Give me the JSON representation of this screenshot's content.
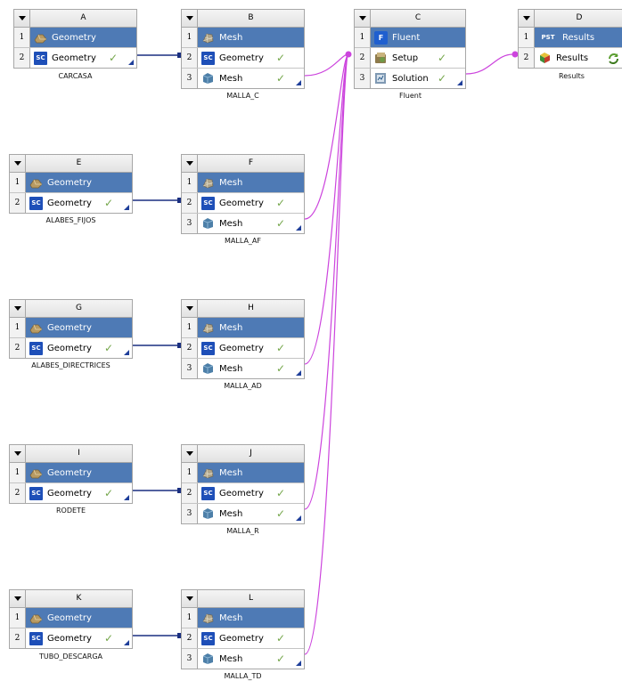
{
  "systems": {
    "A": {
      "letter": "A",
      "name": "CARCASA",
      "rows": [
        {
          "num": "1",
          "label": "Geometry"
        },
        {
          "num": "2",
          "label": "Geometry"
        }
      ]
    },
    "B": {
      "letter": "B",
      "name": "MALLA_C",
      "rows": [
        {
          "num": "1",
          "label": "Mesh"
        },
        {
          "num": "2",
          "label": "Geometry"
        },
        {
          "num": "3",
          "label": "Mesh"
        }
      ]
    },
    "C": {
      "letter": "C",
      "name": "Fluent",
      "rows": [
        {
          "num": "1",
          "label": "Fluent"
        },
        {
          "num": "2",
          "label": "Setup"
        },
        {
          "num": "3",
          "label": "Solution"
        }
      ]
    },
    "D": {
      "letter": "D",
      "name": "Results",
      "rows": [
        {
          "num": "1",
          "label": "Results"
        },
        {
          "num": "2",
          "label": "Results"
        }
      ]
    },
    "E": {
      "letter": "E",
      "name": "ALABES_FIJOS",
      "rows": [
        {
          "num": "1",
          "label": "Geometry"
        },
        {
          "num": "2",
          "label": "Geometry"
        }
      ]
    },
    "F": {
      "letter": "F",
      "name": "MALLA_AF",
      "rows": [
        {
          "num": "1",
          "label": "Mesh"
        },
        {
          "num": "2",
          "label": "Geometry"
        },
        {
          "num": "3",
          "label": "Mesh"
        }
      ]
    },
    "G": {
      "letter": "G",
      "name": "ALABES_DIRECTRICES",
      "rows": [
        {
          "num": "1",
          "label": "Geometry"
        },
        {
          "num": "2",
          "label": "Geometry"
        }
      ]
    },
    "H": {
      "letter": "H",
      "name": "MALLA_AD",
      "rows": [
        {
          "num": "1",
          "label": "Mesh"
        },
        {
          "num": "2",
          "label": "Geometry"
        },
        {
          "num": "3",
          "label": "Mesh"
        }
      ]
    },
    "I": {
      "letter": "I",
      "name": "RODETE",
      "rows": [
        {
          "num": "1",
          "label": "Geometry"
        },
        {
          "num": "2",
          "label": "Geometry"
        }
      ]
    },
    "J": {
      "letter": "J",
      "name": "MALLA_R",
      "rows": [
        {
          "num": "1",
          "label": "Mesh"
        },
        {
          "num": "2",
          "label": "Geometry"
        },
        {
          "num": "3",
          "label": "Mesh"
        }
      ]
    },
    "K": {
      "letter": "K",
      "name": "TUBO_DESCARGA",
      "rows": [
        {
          "num": "1",
          "label": "Geometry"
        },
        {
          "num": "2",
          "label": "Geometry"
        }
      ]
    },
    "L": {
      "letter": "L",
      "name": "MALLA_TD",
      "rows": [
        {
          "num": "1",
          "label": "Mesh"
        },
        {
          "num": "2",
          "label": "Geometry"
        },
        {
          "num": "3",
          "label": "Mesh"
        }
      ]
    }
  },
  "icons": {
    "sc_badge": "SC",
    "fluent_badge": "F",
    "results_badge": "PST",
    "status_check": "✓"
  },
  "colors": {
    "header_blue": "#4e7ab5",
    "geometry_link": "#1a2f80",
    "mesh_link": "#cc44dd",
    "check_green": "#74a64a"
  }
}
